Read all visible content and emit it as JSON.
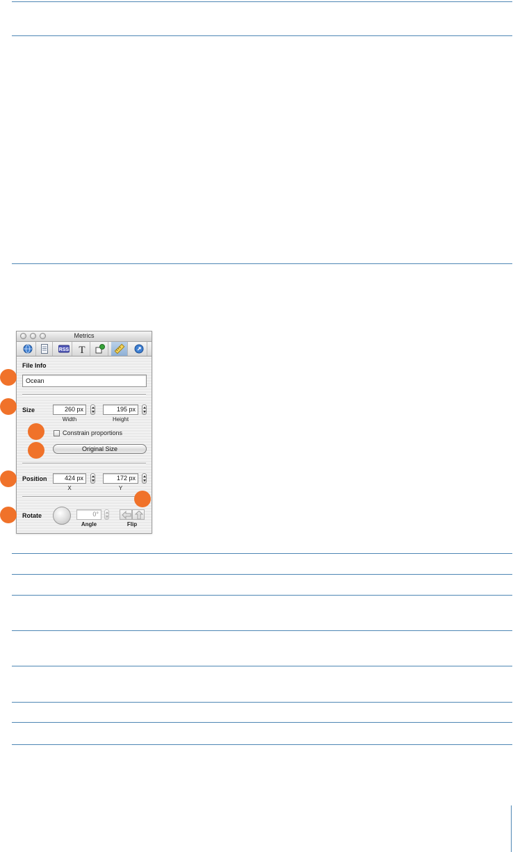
{
  "window": {
    "title": "Metrics"
  },
  "toolbar": {
    "tabs": [
      {
        "icon": "globe-icon"
      },
      {
        "icon": "document-icon"
      },
      {
        "icon": "rss-icon",
        "label": "RSS"
      },
      {
        "icon": "text-icon",
        "label": "T"
      },
      {
        "icon": "graphic-icon"
      },
      {
        "icon": "ruler-icon",
        "selected": true
      },
      {
        "icon": "link-icon"
      }
    ]
  },
  "file_info": {
    "label": "File Info",
    "name_value": "Ocean"
  },
  "size": {
    "label": "Size",
    "width_value": "260 px",
    "width_caption": "Width",
    "height_value": "195 px",
    "height_caption": "Height",
    "constrain_label": "Constrain proportions",
    "constrain_checked": false,
    "original_size_label": "Original Size"
  },
  "position": {
    "label": "Position",
    "x_value": "424 px",
    "x_caption": "X",
    "y_value": "172 px",
    "y_caption": "Y"
  },
  "rotate": {
    "label": "Rotate",
    "angle_value": "0°",
    "angle_caption": "Angle",
    "flip_caption": "Flip"
  },
  "colors": {
    "callout": "#f0722a",
    "rule": "#4d86b4"
  }
}
